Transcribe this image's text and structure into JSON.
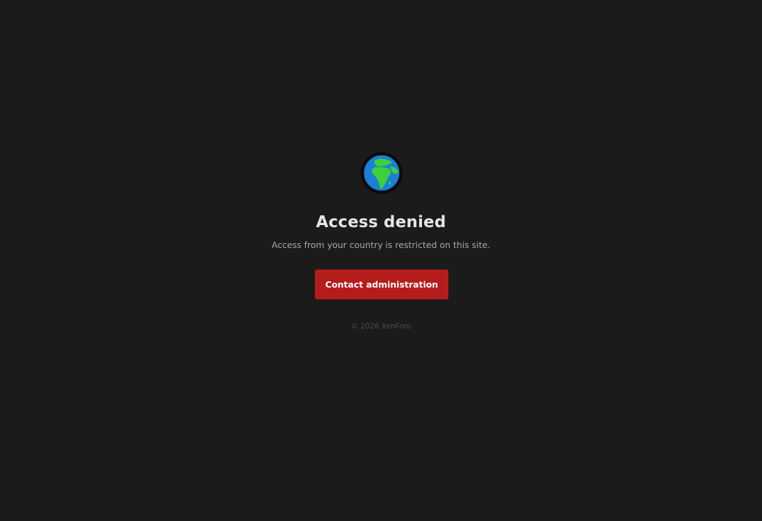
{
  "page": {
    "background_color": "#1b1b1b",
    "icon": "globe-europe-africa-icon",
    "title": "Access denied",
    "message": "Access from your country is restricted on this site.",
    "button_label": "Contact administration",
    "button_color": "#b51c1c",
    "footer": "© 2026 XenForo"
  }
}
